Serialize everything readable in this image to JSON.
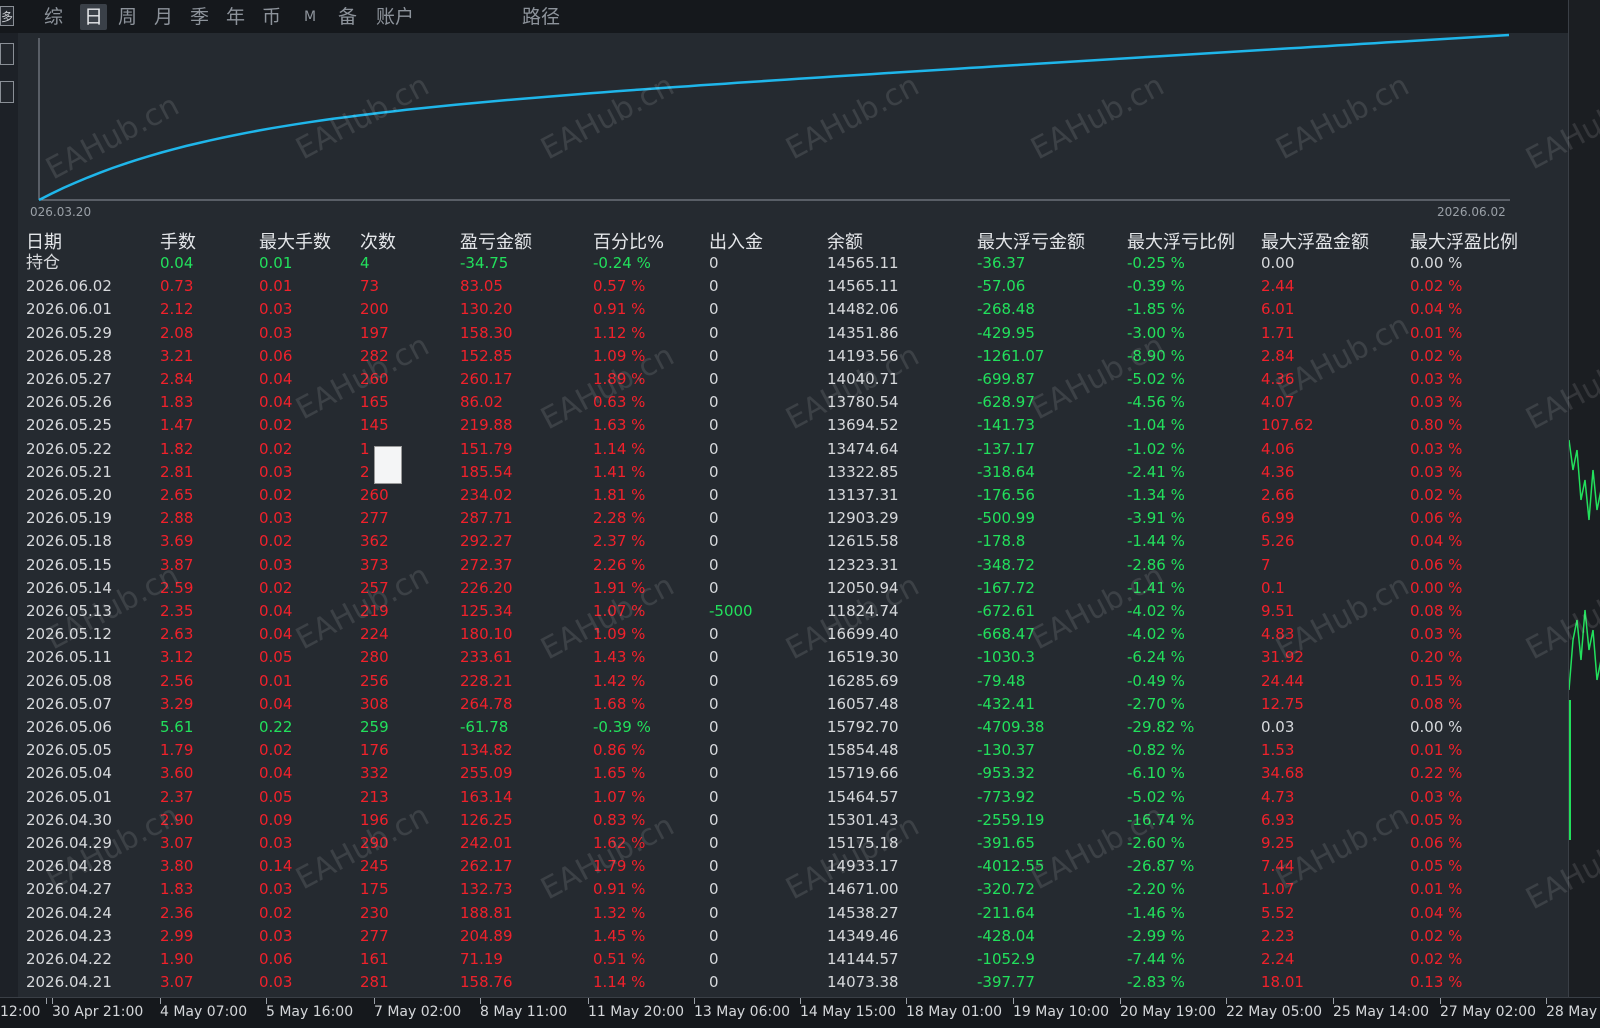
{
  "toolbar": {
    "tabs": [
      "综",
      "日",
      "周",
      "月",
      "季",
      "年",
      "币",
      "M",
      "备",
      "账户"
    ],
    "active": "日",
    "path_label": "路径",
    "edge_button": "多"
  },
  "equity_chart": {
    "start_date": "026.03.20",
    "end_date": "2026.06.02",
    "line_color": "#1fb6ea"
  },
  "table": {
    "headers": [
      "日期",
      "手数",
      "最大手数",
      "次数",
      "盈亏金额",
      "百分比%",
      "出入金",
      "余额",
      "最大浮亏金额",
      "最大浮亏比例",
      "最大浮盈金额",
      "最大浮盈比例"
    ],
    "rows": [
      {
        "date": "持仓",
        "lots": "0.04",
        "max_lots": "0.01",
        "count": "4",
        "pnl": "-34.75",
        "pct": "-0.24 %",
        "flow": "0",
        "balance": "14565.11",
        "max_float_loss": "-36.37",
        "max_float_loss_pct": "-0.25 %",
        "max_float_profit": "0.00",
        "max_float_profit_pct": "0.00 %",
        "lc": "green",
        "pc": "gray"
      },
      {
        "date": "2026.06.02",
        "lots": "0.73",
        "max_lots": "0.01",
        "count": "73",
        "pnl": "83.05",
        "pct": "0.57 %",
        "flow": "0",
        "balance": "14565.11",
        "max_float_loss": "-57.06",
        "max_float_loss_pct": "-0.39 %",
        "max_float_profit": "2.44",
        "max_float_profit_pct": "0.02 %",
        "lc": "red",
        "pc": "red"
      },
      {
        "date": "2026.06.01",
        "lots": "2.12",
        "max_lots": "0.03",
        "count": "200",
        "pnl": "130.20",
        "pct": "0.91 %",
        "flow": "0",
        "balance": "14482.06",
        "max_float_loss": "-268.48",
        "max_float_loss_pct": "-1.85 %",
        "max_float_profit": "6.01",
        "max_float_profit_pct": "0.04 %",
        "lc": "red",
        "pc": "red"
      },
      {
        "date": "2026.05.29",
        "lots": "2.08",
        "max_lots": "0.03",
        "count": "197",
        "pnl": "158.30",
        "pct": "1.12 %",
        "flow": "0",
        "balance": "14351.86",
        "max_float_loss": "-429.95",
        "max_float_loss_pct": "-3.00 %",
        "max_float_profit": "1.71",
        "max_float_profit_pct": "0.01 %",
        "lc": "red",
        "pc": "red"
      },
      {
        "date": "2026.05.28",
        "lots": "3.21",
        "max_lots": "0.06",
        "count": "282",
        "pnl": "152.85",
        "pct": "1.09 %",
        "flow": "0",
        "balance": "14193.56",
        "max_float_loss": "-1261.07",
        "max_float_loss_pct": "-8.90 %",
        "max_float_profit": "2.84",
        "max_float_profit_pct": "0.02 %",
        "lc": "red",
        "pc": "red"
      },
      {
        "date": "2026.05.27",
        "lots": "2.84",
        "max_lots": "0.04",
        "count": "260",
        "pnl": "260.17",
        "pct": "1.89 %",
        "flow": "0",
        "balance": "14040.71",
        "max_float_loss": "-699.87",
        "max_float_loss_pct": "-5.02 %",
        "max_float_profit": "4.36",
        "max_float_profit_pct": "0.03 %",
        "lc": "red",
        "pc": "red"
      },
      {
        "date": "2026.05.26",
        "lots": "1.83",
        "max_lots": "0.04",
        "count": "165",
        "pnl": "86.02",
        "pct": "0.63 %",
        "flow": "0",
        "balance": "13780.54",
        "max_float_loss": "-628.97",
        "max_float_loss_pct": "-4.56 %",
        "max_float_profit": "4.07",
        "max_float_profit_pct": "0.03 %",
        "lc": "red",
        "pc": "red"
      },
      {
        "date": "2026.05.25",
        "lots": "1.47",
        "max_lots": "0.02",
        "count": "145",
        "pnl": "219.88",
        "pct": "1.63 %",
        "flow": "0",
        "balance": "13694.52",
        "max_float_loss": "-141.73",
        "max_float_loss_pct": "-1.04 %",
        "max_float_profit": "107.62",
        "max_float_profit_pct": "0.80 %",
        "lc": "red",
        "pc": "red"
      },
      {
        "date": "2026.05.22",
        "lots": "1.82",
        "max_lots": "0.02",
        "count": "1",
        "pnl": "151.79",
        "pct": "1.14 %",
        "flow": "0",
        "balance": "13474.64",
        "max_float_loss": "-137.17",
        "max_float_loss_pct": "-1.02 %",
        "max_float_profit": "4.06",
        "max_float_profit_pct": "0.03 %",
        "lc": "red",
        "pc": "red"
      },
      {
        "date": "2026.05.21",
        "lots": "2.81",
        "max_lots": "0.03",
        "count": "2",
        "pnl": "185.54",
        "pct": "1.41 %",
        "flow": "0",
        "balance": "13322.85",
        "max_float_loss": "-318.64",
        "max_float_loss_pct": "-2.41 %",
        "max_float_profit": "4.36",
        "max_float_profit_pct": "0.03 %",
        "lc": "red",
        "pc": "red"
      },
      {
        "date": "2026.05.20",
        "lots": "2.65",
        "max_lots": "0.02",
        "count": "260",
        "pnl": "234.02",
        "pct": "1.81 %",
        "flow": "0",
        "balance": "13137.31",
        "max_float_loss": "-176.56",
        "max_float_loss_pct": "-1.34 %",
        "max_float_profit": "2.66",
        "max_float_profit_pct": "0.02 %",
        "lc": "red",
        "pc": "red"
      },
      {
        "date": "2026.05.19",
        "lots": "2.88",
        "max_lots": "0.03",
        "count": "277",
        "pnl": "287.71",
        "pct": "2.28 %",
        "flow": "0",
        "balance": "12903.29",
        "max_float_loss": "-500.99",
        "max_float_loss_pct": "-3.91 %",
        "max_float_profit": "6.99",
        "max_float_profit_pct": "0.06 %",
        "lc": "red",
        "pc": "red"
      },
      {
        "date": "2026.05.18",
        "lots": "3.69",
        "max_lots": "0.02",
        "count": "362",
        "pnl": "292.27",
        "pct": "2.37 %",
        "flow": "0",
        "balance": "12615.58",
        "max_float_loss": "-178.8",
        "max_float_loss_pct": "-1.44 %",
        "max_float_profit": "5.26",
        "max_float_profit_pct": "0.04 %",
        "lc": "red",
        "pc": "red"
      },
      {
        "date": "2026.05.15",
        "lots": "3.87",
        "max_lots": "0.03",
        "count": "373",
        "pnl": "272.37",
        "pct": "2.26 %",
        "flow": "0",
        "balance": "12323.31",
        "max_float_loss": "-348.72",
        "max_float_loss_pct": "-2.86 %",
        "max_float_profit": "7",
        "max_float_profit_pct": "0.06 %",
        "lc": "red",
        "pc": "red"
      },
      {
        "date": "2026.05.14",
        "lots": "2.59",
        "max_lots": "0.02",
        "count": "257",
        "pnl": "226.20",
        "pct": "1.91 %",
        "flow": "0",
        "balance": "12050.94",
        "max_float_loss": "-167.72",
        "max_float_loss_pct": "-1.41 %",
        "max_float_profit": "0.1",
        "max_float_profit_pct": "0.00 %",
        "lc": "red",
        "pc": "red"
      },
      {
        "date": "2026.05.13",
        "lots": "2.35",
        "max_lots": "0.04",
        "count": "219",
        "pnl": "125.34",
        "pct": "1.07 %",
        "flow": "-5000",
        "balance": "11824.74",
        "max_float_loss": "-672.61",
        "max_float_loss_pct": "-4.02 %",
        "max_float_profit": "9.51",
        "max_float_profit_pct": "0.08 %",
        "lc": "red",
        "pc": "red",
        "fc": "green"
      },
      {
        "date": "2026.05.12",
        "lots": "2.63",
        "max_lots": "0.04",
        "count": "224",
        "pnl": "180.10",
        "pct": "1.09 %",
        "flow": "0",
        "balance": "16699.40",
        "max_float_loss": "-668.47",
        "max_float_loss_pct": "-4.02 %",
        "max_float_profit": "4.83",
        "max_float_profit_pct": "0.03 %",
        "lc": "red",
        "pc": "red"
      },
      {
        "date": "2026.05.11",
        "lots": "3.12",
        "max_lots": "0.05",
        "count": "280",
        "pnl": "233.61",
        "pct": "1.43 %",
        "flow": "0",
        "balance": "16519.30",
        "max_float_loss": "-1030.3",
        "max_float_loss_pct": "-6.24 %",
        "max_float_profit": "31.92",
        "max_float_profit_pct": "0.20 %",
        "lc": "red",
        "pc": "red"
      },
      {
        "date": "2026.05.08",
        "lots": "2.56",
        "max_lots": "0.01",
        "count": "256",
        "pnl": "228.21",
        "pct": "1.42 %",
        "flow": "0",
        "balance": "16285.69",
        "max_float_loss": "-79.48",
        "max_float_loss_pct": "-0.49 %",
        "max_float_profit": "24.44",
        "max_float_profit_pct": "0.15 %",
        "lc": "red",
        "pc": "red"
      },
      {
        "date": "2026.05.07",
        "lots": "3.29",
        "max_lots": "0.04",
        "count": "308",
        "pnl": "264.78",
        "pct": "1.68 %",
        "flow": "0",
        "balance": "16057.48",
        "max_float_loss": "-432.41",
        "max_float_loss_pct": "-2.70 %",
        "max_float_profit": "12.75",
        "max_float_profit_pct": "0.08 %",
        "lc": "red",
        "pc": "red"
      },
      {
        "date": "2026.05.06",
        "lots": "5.61",
        "max_lots": "0.22",
        "count": "259",
        "pnl": "-61.78",
        "pct": "-0.39 %",
        "flow": "0",
        "balance": "15792.70",
        "max_float_loss": "-4709.38",
        "max_float_loss_pct": "-29.82 %",
        "max_float_profit": "0.03",
        "max_float_profit_pct": "0.00 %",
        "lc": "green",
        "pc": "red",
        "ppc": "gray"
      },
      {
        "date": "2026.05.05",
        "lots": "1.79",
        "max_lots": "0.02",
        "count": "176",
        "pnl": "134.82",
        "pct": "0.86 %",
        "flow": "0",
        "balance": "15854.48",
        "max_float_loss": "-130.37",
        "max_float_loss_pct": "-0.82 %",
        "max_float_profit": "1.53",
        "max_float_profit_pct": "0.01 %",
        "lc": "red",
        "pc": "red"
      },
      {
        "date": "2026.05.04",
        "lots": "3.60",
        "max_lots": "0.04",
        "count": "332",
        "pnl": "255.09",
        "pct": "1.65 %",
        "flow": "0",
        "balance": "15719.66",
        "max_float_loss": "-953.32",
        "max_float_loss_pct": "-6.10 %",
        "max_float_profit": "34.68",
        "max_float_profit_pct": "0.22 %",
        "lc": "red",
        "pc": "red"
      },
      {
        "date": "2026.05.01",
        "lots": "2.37",
        "max_lots": "0.05",
        "count": "213",
        "pnl": "163.14",
        "pct": "1.07 %",
        "flow": "0",
        "balance": "15464.57",
        "max_float_loss": "-773.92",
        "max_float_loss_pct": "-5.02 %",
        "max_float_profit": "4.73",
        "max_float_profit_pct": "0.03 %",
        "lc": "red",
        "pc": "red"
      },
      {
        "date": "2026.04.30",
        "lots": "2.90",
        "max_lots": "0.09",
        "count": "196",
        "pnl": "126.25",
        "pct": "0.83 %",
        "flow": "0",
        "balance": "15301.43",
        "max_float_loss": "-2559.19",
        "max_float_loss_pct": "-16.74 %",
        "max_float_profit": "6.93",
        "max_float_profit_pct": "0.05 %",
        "lc": "red",
        "pc": "red"
      },
      {
        "date": "2026.04.29",
        "lots": "3.07",
        "max_lots": "0.03",
        "count": "290",
        "pnl": "242.01",
        "pct": "1.62 %",
        "flow": "0",
        "balance": "15175.18",
        "max_float_loss": "-391.65",
        "max_float_loss_pct": "-2.60 %",
        "max_float_profit": "9.25",
        "max_float_profit_pct": "0.06 %",
        "lc": "red",
        "pc": "red"
      },
      {
        "date": "2026.04.28",
        "lots": "3.80",
        "max_lots": "0.14",
        "count": "245",
        "pnl": "262.17",
        "pct": "1.79 %",
        "flow": "0",
        "balance": "14933.17",
        "max_float_loss": "-4012.55",
        "max_float_loss_pct": "-26.87 %",
        "max_float_profit": "7.44",
        "max_float_profit_pct": "0.05 %",
        "lc": "red",
        "pc": "red"
      },
      {
        "date": "2026.04.27",
        "lots": "1.83",
        "max_lots": "0.03",
        "count": "175",
        "pnl": "132.73",
        "pct": "0.91 %",
        "flow": "0",
        "balance": "14671.00",
        "max_float_loss": "-320.72",
        "max_float_loss_pct": "-2.20 %",
        "max_float_profit": "1.07",
        "max_float_profit_pct": "0.01 %",
        "lc": "red",
        "pc": "red"
      },
      {
        "date": "2026.04.24",
        "lots": "2.36",
        "max_lots": "0.02",
        "count": "230",
        "pnl": "188.81",
        "pct": "1.32 %",
        "flow": "0",
        "balance": "14538.27",
        "max_float_loss": "-211.64",
        "max_float_loss_pct": "-1.46 %",
        "max_float_profit": "5.52",
        "max_float_profit_pct": "0.04 %",
        "lc": "red",
        "pc": "red"
      },
      {
        "date": "2026.04.23",
        "lots": "2.99",
        "max_lots": "0.03",
        "count": "277",
        "pnl": "204.89",
        "pct": "1.45 %",
        "flow": "0",
        "balance": "14349.46",
        "max_float_loss": "-428.04",
        "max_float_loss_pct": "-2.99 %",
        "max_float_profit": "2.23",
        "max_float_profit_pct": "0.02 %",
        "lc": "red",
        "pc": "red"
      },
      {
        "date": "2026.04.22",
        "lots": "1.90",
        "max_lots": "0.06",
        "count": "161",
        "pnl": "71.19",
        "pct": "0.51 %",
        "flow": "0",
        "balance": "14144.57",
        "max_float_loss": "-1052.9",
        "max_float_loss_pct": "-7.44 %",
        "max_float_profit": "2.24",
        "max_float_profit_pct": "0.02 %",
        "lc": "red",
        "pc": "red"
      },
      {
        "date": "2026.04.21",
        "lots": "3.07",
        "max_lots": "0.03",
        "count": "281",
        "pnl": "158.76",
        "pct": "1.14 %",
        "flow": "0",
        "balance": "14073.38",
        "max_float_loss": "-397.77",
        "max_float_loss_pct": "-2.83 %",
        "max_float_profit": "18.01",
        "max_float_profit_pct": "0.13 %",
        "lc": "red",
        "pc": "red"
      }
    ]
  },
  "time_axis": [
    "12:00",
    "30 Apr 21:00",
    "4 May 07:00",
    "5 May 16:00",
    "7 May 02:00",
    "8 May 11:00",
    "11 May 20:00",
    "13 May 06:00",
    "14 May 15:00",
    "18 May 01:00",
    "19 May 10:00",
    "20 May 19:00",
    "22 May 05:00",
    "25 May 14:00",
    "27 May 02:00",
    "28 May"
  ],
  "watermark": "EAHub.cn",
  "colors": {
    "profit": "#f0212b",
    "loss": "#22e05c",
    "neutral": "#d7d9dc",
    "equity": "#1fb6ea"
  }
}
